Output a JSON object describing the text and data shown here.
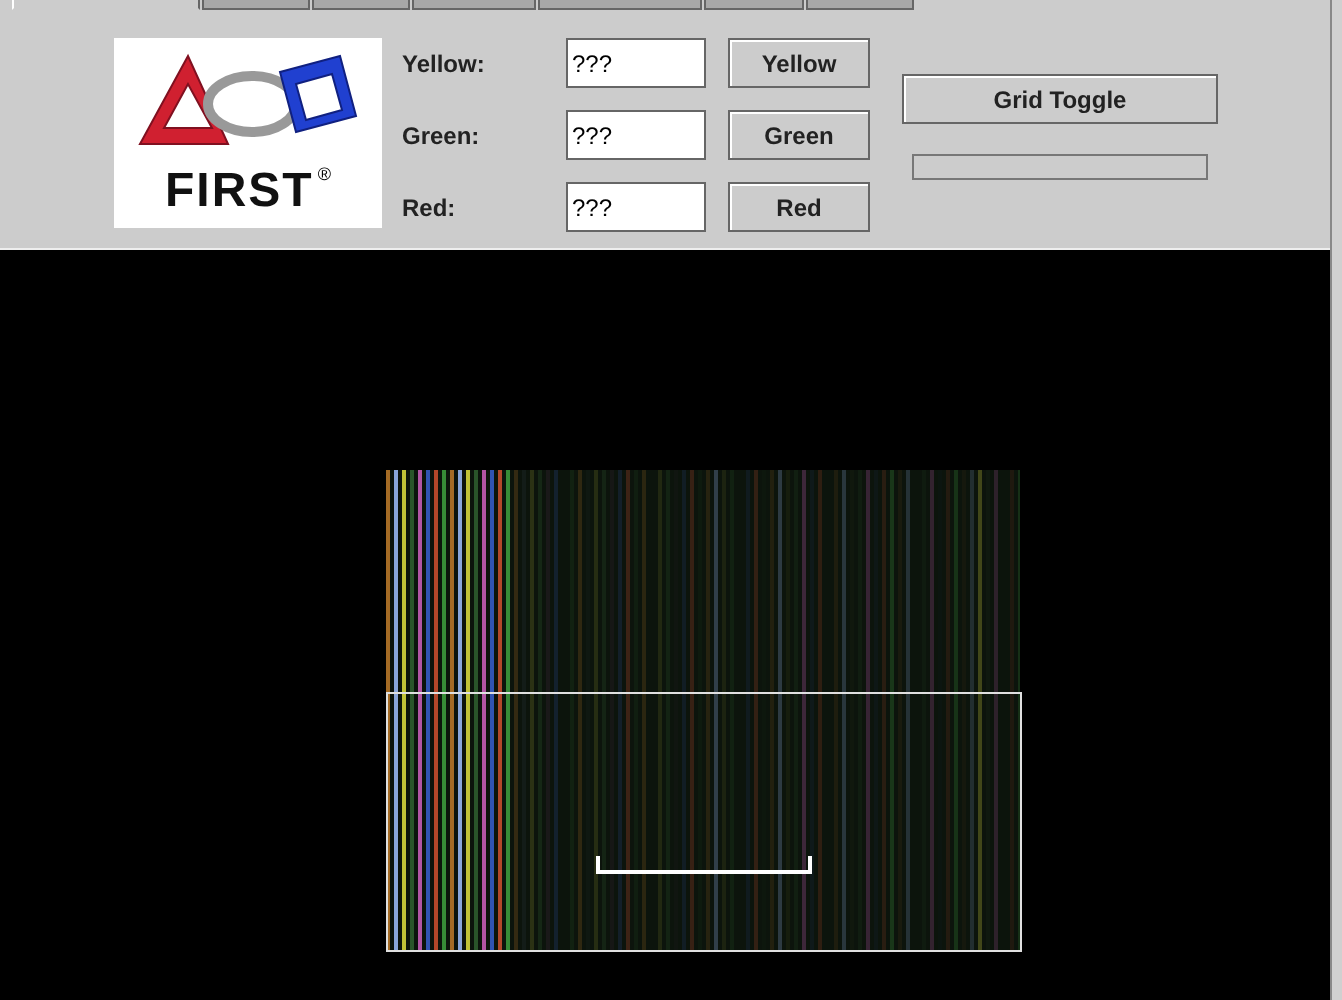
{
  "tabs": [
    {
      "selected": true
    },
    {
      "selected": false
    },
    {
      "selected": false
    },
    {
      "selected": false
    },
    {
      "selected": false
    },
    {
      "selected": false
    },
    {
      "selected": false
    }
  ],
  "logo": {
    "wordmark": "FIRST",
    "mark": "®"
  },
  "channels": [
    {
      "label": "Yellow:",
      "value": "???",
      "button": "Yellow"
    },
    {
      "label": "Green:",
      "value": "???",
      "button": "Green"
    },
    {
      "label": "Red:",
      "value": "???",
      "button": "Red"
    }
  ],
  "grid_button": "Grid Toggle",
  "progress": {
    "level": 0
  }
}
